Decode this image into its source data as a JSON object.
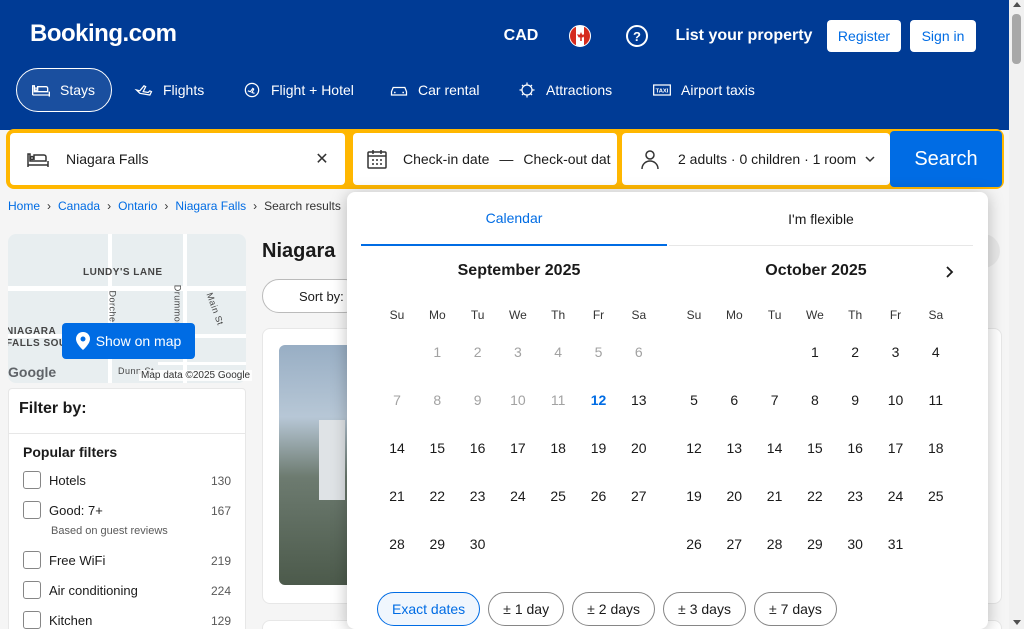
{
  "header": {
    "logo": "Booking.com",
    "currency": "CAD",
    "help": "?",
    "list_property": "List your property",
    "register": "Register",
    "sign_in": "Sign in"
  },
  "nav": {
    "stays": "Stays",
    "flights": "Flights",
    "flight_hotel": "Flight + Hotel",
    "car_rental": "Car rental",
    "attractions": "Attractions",
    "airport_taxis": "Airport taxis"
  },
  "search": {
    "destination": "Niagara Falls",
    "checkin": "Check-in date",
    "checkout": "Check-out date",
    "dash": "—",
    "guests": "2 adults · 0 children · 1 room",
    "button": "Search"
  },
  "breadcrumb": {
    "home": "Home",
    "canada": "Canada",
    "ontario": "Ontario",
    "niagara": "Niagara Falls",
    "current": "Search results"
  },
  "map": {
    "label1": "LUNDY'S LANE",
    "label2": "NIAGARA",
    "label3": "FALLS SOUTH",
    "label4": "Dorchester",
    "label5": "Drummond",
    "label6": "Main St",
    "label7": "Dunn St",
    "button": "Show on map",
    "google": "Google",
    "credit": "Map data ©2025 Google"
  },
  "filters": {
    "title": "Filter by:",
    "popular": "Popular filters",
    "items": [
      {
        "label": "Hotels",
        "count": "130"
      },
      {
        "label": "Good: 7+",
        "count": "167"
      },
      {
        "label": "Free WiFi",
        "count": "219"
      },
      {
        "label": "Air conditioning",
        "count": "224"
      },
      {
        "label": "Kitchen",
        "count": "129"
      }
    ],
    "note": "Based on guest reviews"
  },
  "results": {
    "title": "Niagara",
    "sort": "Sort by:"
  },
  "calendar": {
    "tab_calendar": "Calendar",
    "tab_flexible": "I'm flexible",
    "weekdays": [
      "Su",
      "Mo",
      "Tu",
      "We",
      "Th",
      "Fr",
      "Sa"
    ],
    "months": [
      {
        "title": "September 2025",
        "weeks": [
          [
            "",
            "1",
            "2",
            "3",
            "4",
            "5",
            "6"
          ],
          [
            "7",
            "8",
            "9",
            "10",
            "11",
            "12",
            "13"
          ],
          [
            "14",
            "15",
            "16",
            "17",
            "18",
            "19",
            "20"
          ],
          [
            "21",
            "22",
            "23",
            "24",
            "25",
            "26",
            "27"
          ],
          [
            "28",
            "29",
            "30",
            "",
            "",
            "",
            ""
          ]
        ]
      },
      {
        "title": "October 2025",
        "weeks": [
          [
            "",
            "",
            "",
            "1",
            "2",
            "3",
            "4"
          ],
          [
            "5",
            "6",
            "7",
            "8",
            "9",
            "10",
            "11"
          ],
          [
            "12",
            "13",
            "14",
            "15",
            "16",
            "17",
            "18"
          ],
          [
            "19",
            "20",
            "21",
            "22",
            "23",
            "24",
            "25"
          ],
          [
            "26",
            "27",
            "28",
            "29",
            "30",
            "31",
            ""
          ]
        ]
      }
    ],
    "today": "12",
    "flex_options": {
      "exact": "Exact dates",
      "one_day": "1 day",
      "two_days": "2 days",
      "three_days": "3 days",
      "seven_days": "7 days",
      "plus_minus": "±"
    }
  },
  "colors": {
    "brand_blue": "#003b95",
    "accent_blue": "#006ce4",
    "search_yellow": "#ffb700"
  }
}
